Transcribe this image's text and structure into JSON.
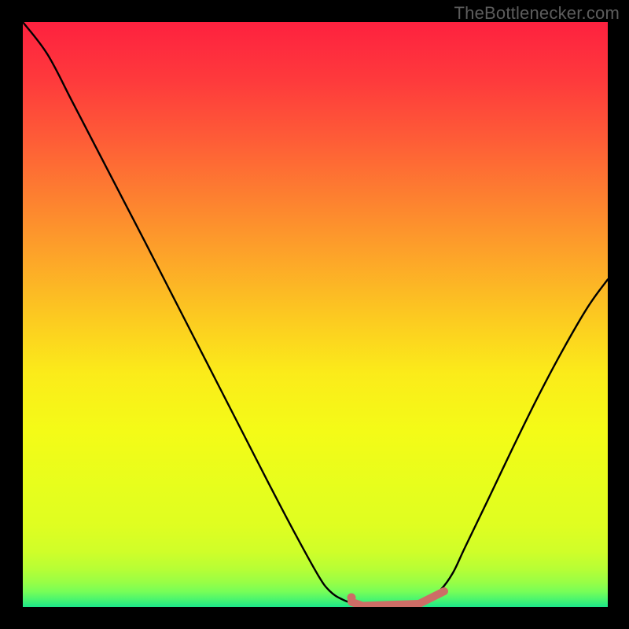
{
  "watermark": "TheBottlenecker.com",
  "colors": {
    "background": "#000000",
    "watermark": "#5c5c5c",
    "curve": "#000000",
    "marker_stroke": "#cd6d66",
    "marker_fill": "#cd6d66",
    "gradient_stops": [
      {
        "offset": 0.0,
        "color": "#fe213f"
      },
      {
        "offset": 0.1,
        "color": "#fe3a3c"
      },
      {
        "offset": 0.2,
        "color": "#fe5c37"
      },
      {
        "offset": 0.3,
        "color": "#fd8030"
      },
      {
        "offset": 0.4,
        "color": "#fda429"
      },
      {
        "offset": 0.5,
        "color": "#fcc821"
      },
      {
        "offset": 0.6,
        "color": "#fbeb1a"
      },
      {
        "offset": 0.7,
        "color": "#f4fb17"
      },
      {
        "offset": 0.8,
        "color": "#e6fe1d"
      },
      {
        "offset": 0.86,
        "color": "#dffe21"
      },
      {
        "offset": 0.905,
        "color": "#d0fe29"
      },
      {
        "offset": 0.935,
        "color": "#b7fe35"
      },
      {
        "offset": 0.958,
        "color": "#98fe46"
      },
      {
        "offset": 0.974,
        "color": "#76fe58"
      },
      {
        "offset": 0.987,
        "color": "#4bf56f"
      },
      {
        "offset": 1.0,
        "color": "#1ce789"
      }
    ]
  },
  "chart_data": {
    "type": "line",
    "title": "",
    "xlabel": "",
    "ylabel": "",
    "xlim": [
      0,
      100
    ],
    "ylim": [
      0,
      100
    ],
    "x": [
      0,
      4.2,
      8.4,
      12.6,
      16.8,
      21.0,
      25.2,
      29.4,
      33.6,
      37.8,
      42.0,
      46.3,
      50.5,
      52.5,
      54.6,
      56.7,
      58.8,
      60.9,
      63.0,
      65.1,
      67.2,
      69.3,
      71.4,
      73.5,
      75.6,
      79.8,
      84.0,
      88.2,
      92.4,
      96.6,
      100
    ],
    "values": [
      100,
      94.5,
      86.5,
      78.4,
      70.3,
      62.2,
      54.0,
      45.8,
      37.6,
      29.4,
      21.2,
      13.0,
      5.4,
      2.7,
      1.3,
      0.55,
      0.24,
      0.12,
      0.12,
      0.24,
      0.55,
      1.3,
      2.9,
      5.8,
      10.2,
      18.9,
      27.7,
      36.2,
      44.1,
      51.3,
      56.0
    ],
    "highlight_segments": [
      {
        "x0": 56.18,
        "y0": 0.86,
        "x1": 58.06,
        "y1": 0.21
      },
      {
        "x0": 58.06,
        "y0": 0.21,
        "x1": 67.74,
        "y1": 0.54
      },
      {
        "x0": 67.74,
        "y0": 0.54,
        "x1": 72.04,
        "y1": 2.69
      }
    ],
    "highlight_point": {
      "x": 56.18,
      "y": 1.61
    }
  }
}
